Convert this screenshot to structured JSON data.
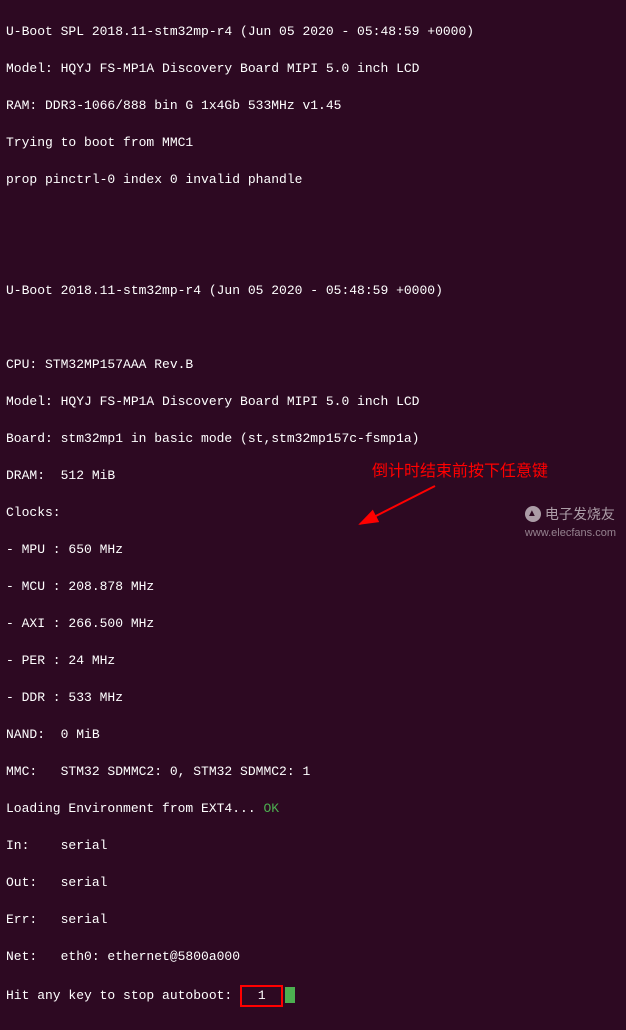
{
  "boot": {
    "spl_line": "U-Boot SPL 2018.11-stm32mp-r4 (Jun 05 2020 - 05:48:59 +0000)",
    "model_line": "Model: HQYJ FS-MP1A Discovery Board MIPI 5.0 inch LCD",
    "ram_line": "RAM: DDR3-1066/888 bin G 1x4Gb 533MHz v1.45",
    "trying_line": "Trying to boot from MMC1",
    "prop_line": "prop pinctrl-0 index 0 invalid phandle",
    "uboot_line": "U-Boot 2018.11-stm32mp-r4 (Jun 05 2020 - 05:48:59 +0000)",
    "cpu_line": "CPU: STM32MP157AAA Rev.B",
    "model2_line": "Model: HQYJ FS-MP1A Discovery Board MIPI 5.0 inch LCD",
    "board_line": "Board: stm32mp1 in basic mode (st,stm32mp157c-fsmp1a)",
    "dram_line": "DRAM:  512 MiB",
    "clocks_line": "Clocks:",
    "mpu_line": "- MPU : 650 MHz",
    "mcu_line": "- MCU : 208.878 MHz",
    "axi_line": "- AXI : 266.500 MHz",
    "per_line": "- PER : 24 MHz",
    "ddr_line": "- DDR : 533 MHz",
    "nand_line": "NAND:  0 MiB",
    "mmc_line": "MMC:   STM32 SDMMC2: 0, STM32 SDMMC2: 1",
    "loading_env_prefix": "Loading Environment from EXT4... ",
    "loading_env_status": "OK",
    "in_line": "In:    serial",
    "out_line": "Out:   serial",
    "err_line": "Err:   serial",
    "net_line": "Net:   eth0: ethernet@5800a000",
    "autoboot_prefix": "Hit any key to stop autoboot: ",
    "autoboot_count": " 1 "
  },
  "annotation": {
    "text": "倒计时结束前按下任意键"
  },
  "watermark": {
    "brand": "电子发烧友",
    "url": "www.elecfans.com"
  }
}
